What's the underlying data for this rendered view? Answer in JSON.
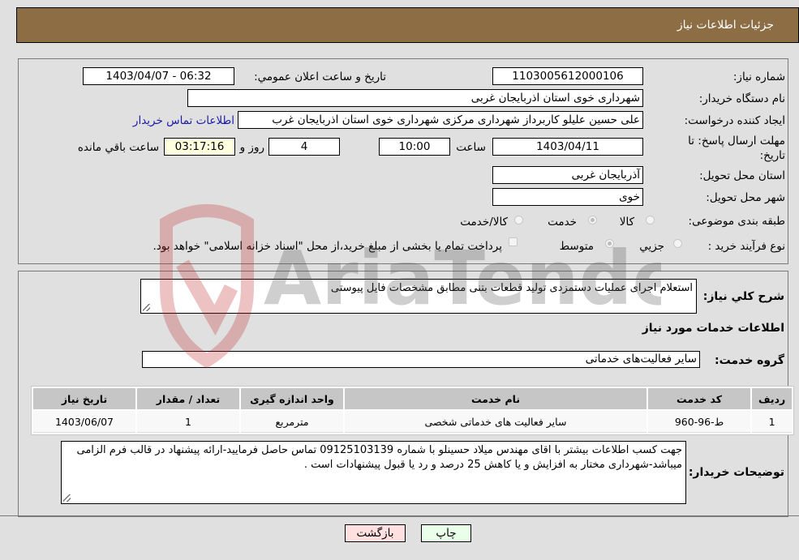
{
  "header": {
    "title": "جزئیات اطلاعات نیاز"
  },
  "form": {
    "need_number": {
      "label": "شماره نیاز:",
      "value": "1103005612000106"
    },
    "announce_datetime": {
      "label": "تاریخ و ساعت اعلان عمومي:",
      "value": "1403/04/07 - 06:32"
    },
    "buyer_org": {
      "label": "نام دستگاه خریدار:",
      "value": "شهرداری خوی استان اذربایجان غربی"
    },
    "requester": {
      "label": "ایجاد کننده درخواست:",
      "value": "علی حسین علیلو کاربرداز شهرداری مرکزی شهرداری خوی استان اذربایجان غرب"
    },
    "contact_link": "اطلاعات تماس خریدار",
    "deadline": {
      "label": "مهلت ارسال پاسخ: تا تاریخ:",
      "date": "1403/04/11",
      "time_label": "ساعت",
      "time": "10:00",
      "days": "4",
      "days_label": "روز و",
      "remaining": "03:17:16",
      "remaining_label": "ساعت باقي مانده"
    },
    "province": {
      "label": "استان محل تحویل:",
      "value": "آذربایجان غربی"
    },
    "city": {
      "label": "شهر محل تحویل:",
      "value": "خوی"
    },
    "category": {
      "label": "طبقه بندی موضوعی:",
      "options": [
        "کالا",
        "خدمت",
        "کالا/خدمت"
      ],
      "selected": "خدمت"
    },
    "purchase_type": {
      "label": "نوع فرآیند خرید :",
      "options": [
        "جزیي",
        "متوسط"
      ],
      "selected": "متوسط",
      "treasury_note": "پرداخت تمام یا بخشی از مبلغ خرید،از محل \"اسناد خزانه اسلامی\" خواهد بود."
    }
  },
  "description": {
    "label": "شرح کلي نیاز:",
    "value": "استعلام اجرای عملیات دستمزدی تولید قطعات بتنی مطابق مشخصات فایل پیوستی"
  },
  "services": {
    "section_title": "اطلاعات خدمات مورد نیاز",
    "group_label": "گروه خدمت:",
    "group_value": "سایر فعالیت‌های خدماتی",
    "table": {
      "headers": [
        "ردیف",
        "کد خدمت",
        "نام خدمت",
        "واحد اندازه گیری",
        "تعداد / مقدار",
        "تاریخ نیاز"
      ],
      "rows": [
        [
          "1",
          "ط-96-960",
          "سایر فعالیت های خدماتی شخصی",
          "مترمربع",
          "1",
          "1403/06/07"
        ]
      ]
    }
  },
  "buyer_notes": {
    "label": "توضیحات خریدار:",
    "value": "جهت کسب اطلاعات بیشتر با اقای مهندس میلاد حسینلو با شماره 09125103139 تماس حاصل فرمایید-ارائه پیشنهاد در قالب فرم الزامی میباشد-شهرداری مختار به افزایش و یا کاهش 25 درصد و رد یا قبول پیشنهادات است ."
  },
  "buttons": {
    "print": "چاپ",
    "back": "بازگشت"
  },
  "colors": {
    "header_bg": "#8c6d44",
    "print_bg": "#eaffea",
    "back_bg": "#ffe0e0",
    "link": "#1a1aa6"
  },
  "watermark": {
    "text": "AriaTender.neT"
  }
}
